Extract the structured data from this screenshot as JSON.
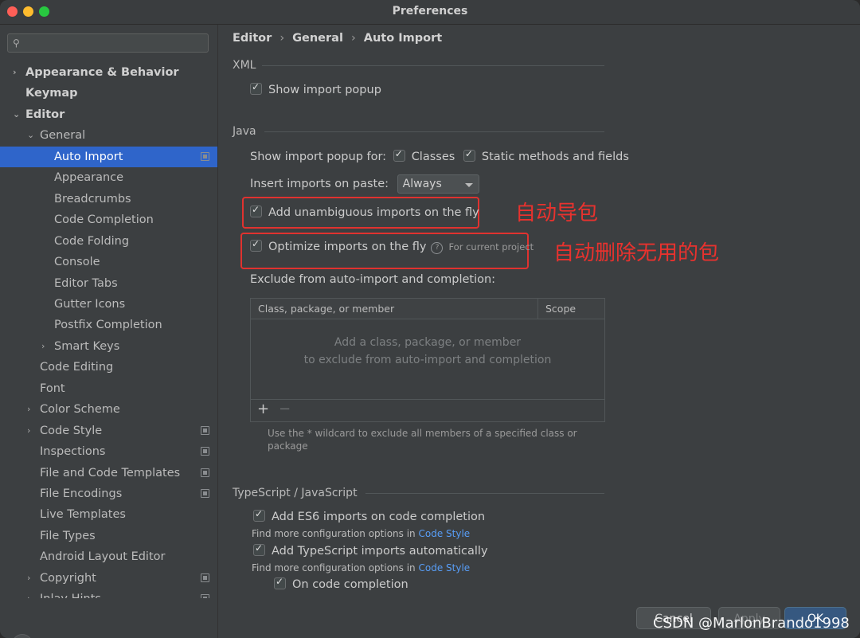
{
  "window": {
    "title": "Preferences"
  },
  "sidebar": {
    "search_placeholder": "",
    "items": [
      {
        "label": "Appearance & Behavior",
        "bold": true,
        "arrow": "›"
      },
      {
        "label": "Keymap",
        "bold": true
      },
      {
        "label": "Editor",
        "bold": true,
        "arrow": "⌄"
      },
      {
        "label": "General",
        "arrow": "⌄"
      },
      {
        "label": "Auto Import",
        "selected": true,
        "project_icon": true
      },
      {
        "label": "Appearance"
      },
      {
        "label": "Breadcrumbs"
      },
      {
        "label": "Code Completion"
      },
      {
        "label": "Code Folding"
      },
      {
        "label": "Console"
      },
      {
        "label": "Editor Tabs"
      },
      {
        "label": "Gutter Icons"
      },
      {
        "label": "Postfix Completion"
      },
      {
        "label": "Smart Keys",
        "arrow": "›"
      },
      {
        "label": "Code Editing"
      },
      {
        "label": "Font"
      },
      {
        "label": "Color Scheme",
        "arrow": "›"
      },
      {
        "label": "Code Style",
        "arrow": "›",
        "project_icon": true
      },
      {
        "label": "Inspections",
        "project_icon": true
      },
      {
        "label": "File and Code Templates",
        "project_icon": true
      },
      {
        "label": "File Encodings",
        "project_icon": true
      },
      {
        "label": "Live Templates"
      },
      {
        "label": "File Types"
      },
      {
        "label": "Android Layout Editor"
      },
      {
        "label": "Copyright",
        "arrow": "›",
        "project_icon": true
      },
      {
        "label": "Inlay Hints",
        "arrow": "›",
        "project_icon": true
      }
    ],
    "help_label": "?"
  },
  "breadcrumb": {
    "items": [
      "Editor",
      "General",
      "Auto Import"
    ],
    "separator": "›"
  },
  "xml": {
    "title": "XML",
    "show_import_popup": "Show import popup",
    "show_import_popup_checked": true
  },
  "java": {
    "title": "Java",
    "show_popup_for": "Show import popup for:",
    "classes": "Classes",
    "classes_checked": true,
    "static_methods": "Static methods and fields",
    "static_methods_checked": true,
    "insert_on_paste": "Insert imports on paste:",
    "insert_on_paste_value": "Always",
    "add_unambiguous": "Add unambiguous imports on the fly",
    "add_unambiguous_checked": true,
    "optimize_imports": "Optimize imports on the fly",
    "optimize_imports_checked": true,
    "help_mark": "?",
    "for_current_project": "For current project",
    "exclude_label": "Exclude from auto-import and completion:",
    "table_col_member": "Class, package, or member",
    "table_col_scope": "Scope",
    "empty_line1": "Add a class, package, or member",
    "empty_line2": "to exclude from auto-import and completion",
    "add_symbol": "+",
    "remove_symbol": "−",
    "wildcard_hint": "Use the * wildcard to exclude all members of a specified class or package"
  },
  "annotations": {
    "auto_import": "自动导包",
    "auto_remove": "自动删除无用的包",
    "color": "#e8322e"
  },
  "typescript": {
    "title": "TypeScript / JavaScript",
    "es6_imports": "Add ES6 imports on code completion",
    "es6_imports_checked": true,
    "find_more_1": "Find more configuration options in ",
    "code_style_link_1": "Code Style",
    "ts_imports": "Add TypeScript imports automatically",
    "ts_imports_checked": true,
    "find_more_2": "Find more configuration options in ",
    "code_style_link_2": "Code Style",
    "on_completion": "On code completion",
    "on_completion_checked": true
  },
  "footer": {
    "cancel": "Cancel",
    "apply": "Apply",
    "ok": "OK"
  },
  "watermark": "CSDN @MarlonBrando1998",
  "colors": {
    "selection": "#2f65ca",
    "link": "#589df6",
    "ok_button": "#365880"
  }
}
